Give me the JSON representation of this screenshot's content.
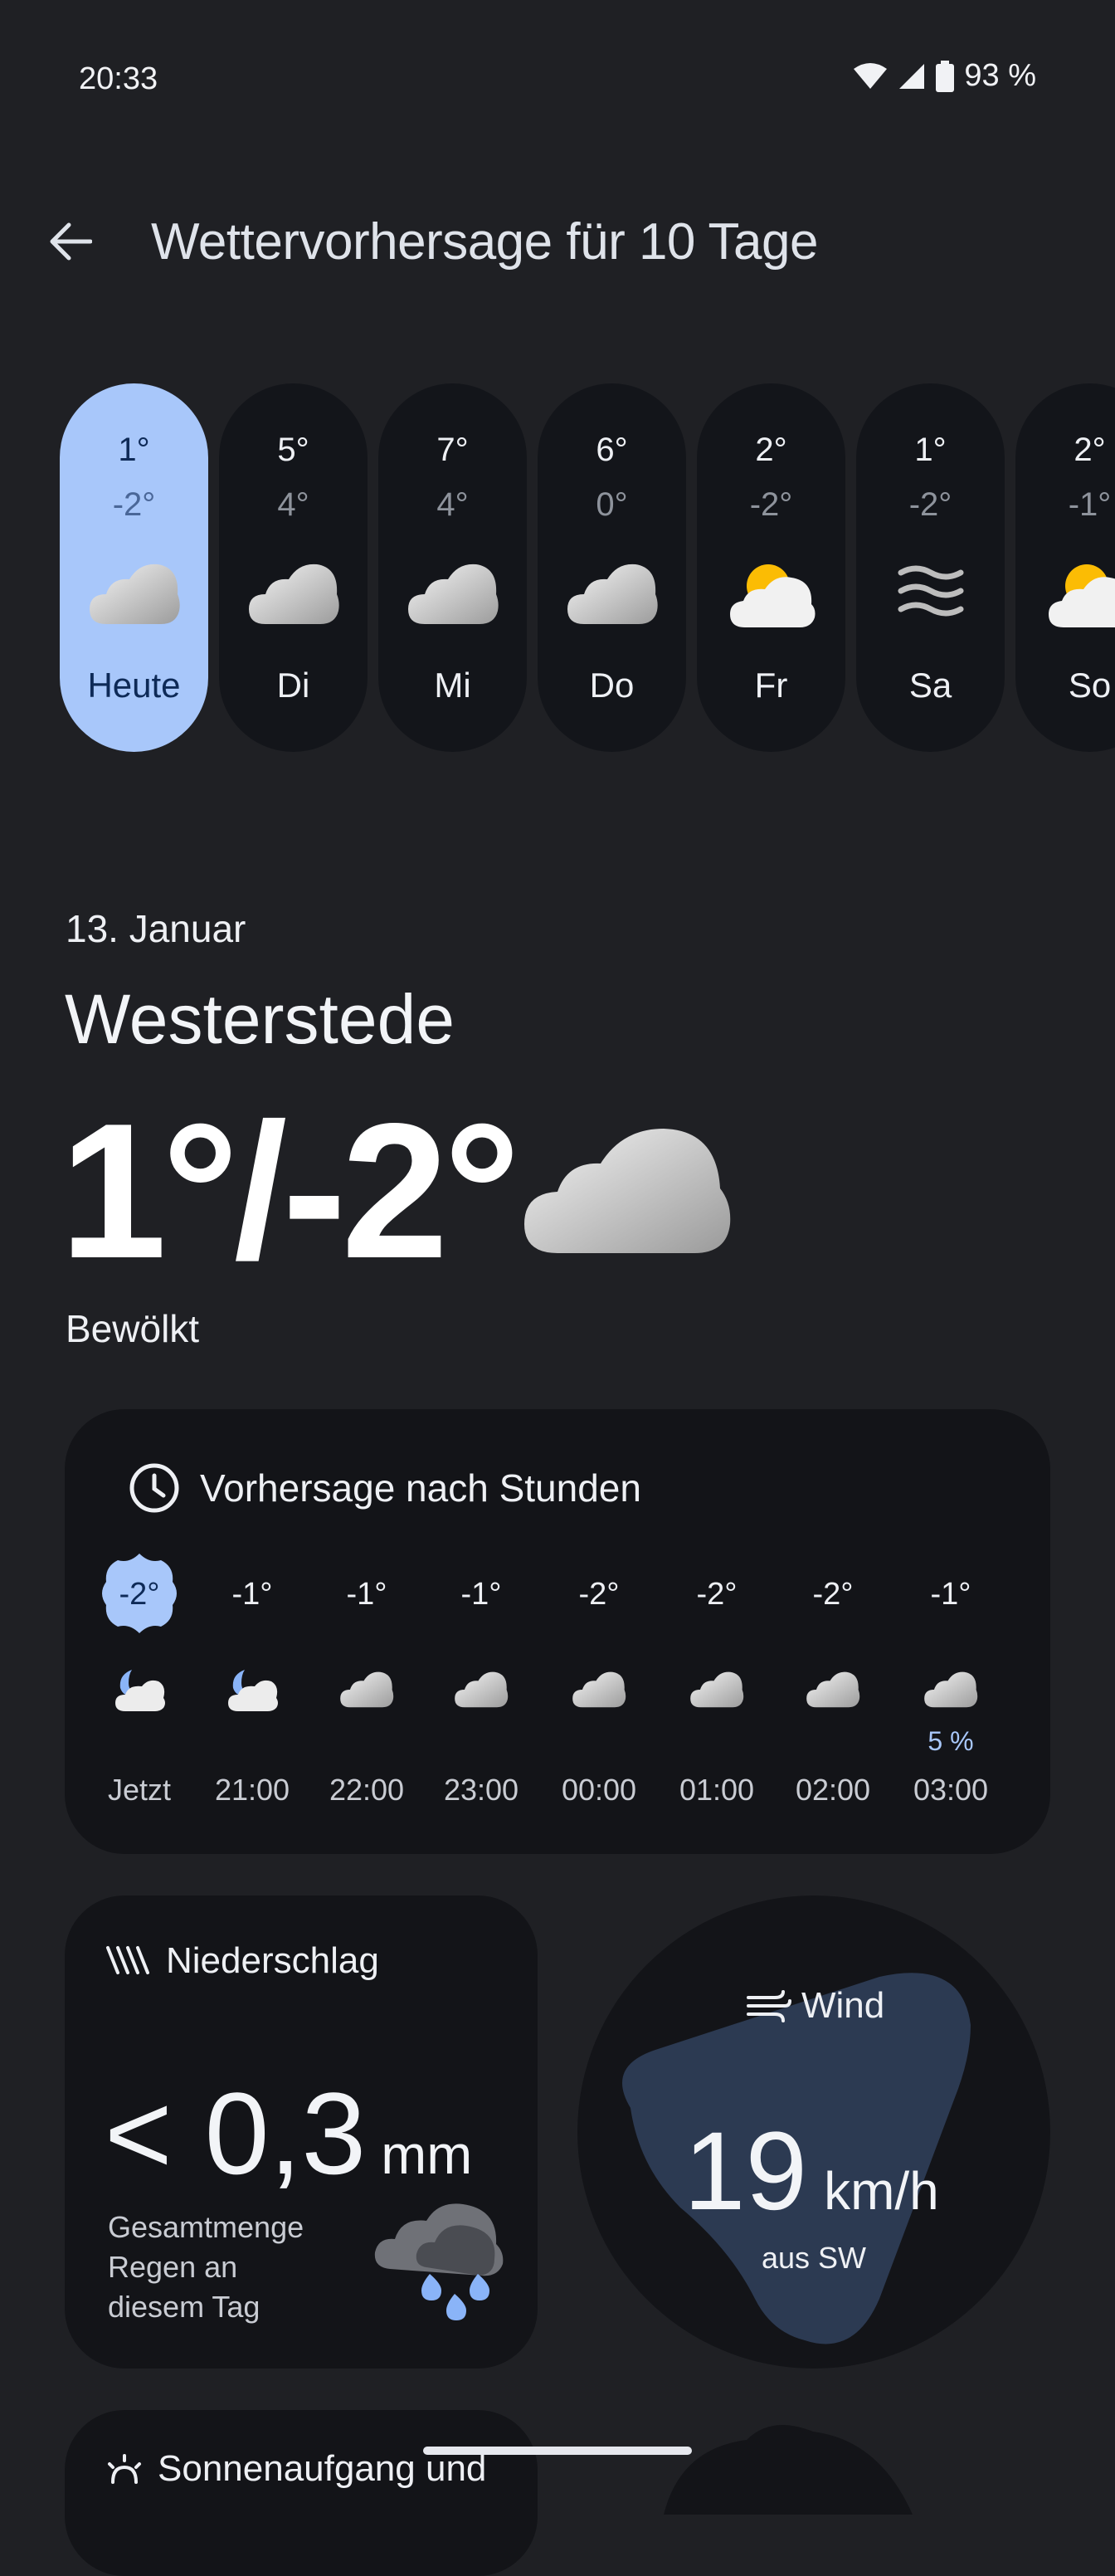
{
  "status": {
    "time": "20:33",
    "battery": "93 %"
  },
  "header": {
    "title": "Wettervorhersage für 10 Tage"
  },
  "days": [
    {
      "label": "Heute",
      "high": "1°",
      "low": "-2°",
      "icon": "cloud-icon",
      "active": true
    },
    {
      "label": "Di",
      "high": "5°",
      "low": "4°",
      "icon": "cloud-icon"
    },
    {
      "label": "Mi",
      "high": "7°",
      "low": "4°",
      "icon": "cloud-icon"
    },
    {
      "label": "Do",
      "high": "6°",
      "low": "0°",
      "icon": "cloud-icon"
    },
    {
      "label": "Fr",
      "high": "2°",
      "low": "-2°",
      "icon": "partly-cloudy-icon"
    },
    {
      "label": "Sa",
      "high": "1°",
      "low": "-2°",
      "icon": "fog-icon"
    },
    {
      "label": "So",
      "high": "2°",
      "low": "-1°",
      "icon": "partly-cloudy-icon"
    }
  ],
  "main": {
    "date": "13. Januar",
    "city": "Westerstede",
    "temp_range": "1°/-2°",
    "condition": "Bewölkt"
  },
  "hourly": {
    "title": "Vorhersage nach Stunden",
    "hours": [
      {
        "temp": "-2°",
        "time": "Jetzt",
        "icon": "moon-cloud-icon",
        "precip": ""
      },
      {
        "temp": "-1°",
        "time": "21:00",
        "icon": "moon-cloud-icon",
        "precip": ""
      },
      {
        "temp": "-1°",
        "time": "22:00",
        "icon": "cloud-icon",
        "precip": ""
      },
      {
        "temp": "-1°",
        "time": "23:00",
        "icon": "cloud-icon",
        "precip": ""
      },
      {
        "temp": "-2°",
        "time": "00:00",
        "icon": "cloud-icon",
        "precip": ""
      },
      {
        "temp": "-2°",
        "time": "01:00",
        "icon": "cloud-icon",
        "precip": ""
      },
      {
        "temp": "-2°",
        "time": "02:00",
        "icon": "cloud-icon",
        "precip": ""
      },
      {
        "temp": "-1°",
        "time": "03:00",
        "icon": "cloud-icon",
        "precip": "5 %"
      }
    ]
  },
  "precipitation": {
    "title": "Niederschlag",
    "value": "< 0,3",
    "unit": "mm",
    "description_line1": "Gesamtmenge",
    "description_line2": "Regen an",
    "description_line3": "diesem Tag"
  },
  "wind": {
    "title": "Wind",
    "value": "19",
    "unit": "km/h",
    "direction": "aus SW"
  },
  "sunrise": {
    "title": "Sonnenaufgang und"
  },
  "colors": {
    "accent": "#a8c7fa",
    "background": "#1f2024",
    "card": "#131418"
  }
}
